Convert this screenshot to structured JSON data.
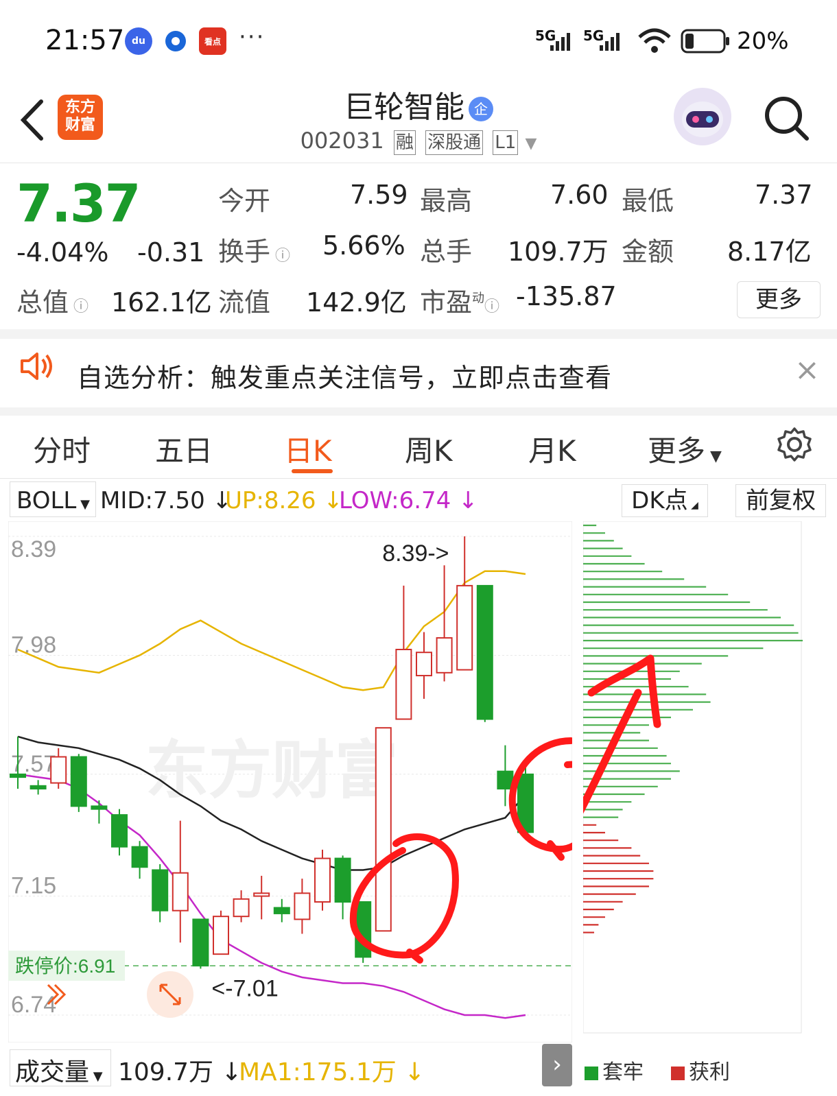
{
  "status_bar": {
    "time": "21:57",
    "app_icons": [
      "baidu-icon",
      "browser-icon",
      "kandian-icon"
    ],
    "app_icon_labels": [
      "du",
      "",
      "看点"
    ],
    "more": "···",
    "network1": "5G",
    "network2": "5G",
    "battery": "20%"
  },
  "header": {
    "logo_line1": "东方",
    "logo_line2": "财富",
    "stock_name": "巨轮智能",
    "name_badge": "企",
    "stock_code": "002031",
    "tags": [
      "融",
      "深股通",
      "L1"
    ]
  },
  "quote": {
    "price": "7.37",
    "change_pct": "-4.04%",
    "change": "-0.31",
    "rows": [
      [
        {
          "label": "今开",
          "value": "7.59",
          "green": true
        },
        {
          "label": "最高",
          "value": "7.60",
          "green": true
        },
        {
          "label": "最低",
          "value": "7.37",
          "green": true
        }
      ],
      [
        {
          "label": "换手",
          "value": "5.66%",
          "green": false
        },
        {
          "label": "总手",
          "value": "109.7万",
          "green": false
        },
        {
          "label": "金额",
          "value": "8.17亿",
          "green": false
        }
      ]
    ],
    "total_value_label": "总值",
    "total_value": "162.1亿",
    "float_value_label": "流值",
    "float_value": "142.9亿",
    "pe_label": "市盈",
    "pe_super": "动",
    "pe_value": "-135.87",
    "more_button": "更多"
  },
  "notice": {
    "text": "自选分析：触发重点关注信号，立即点击查看",
    "close": "×"
  },
  "tabs": {
    "items": [
      "分时",
      "五日",
      "日K",
      "周K",
      "月K",
      "更多"
    ],
    "active": "日K"
  },
  "indicator": {
    "name": "BOLL",
    "mid": "MID:7.50",
    "up": "UP:8.26",
    "low": "LOW:6.74",
    "dk_button": "DK点",
    "adjust_button": "前复权",
    "colors": {
      "mid": "#222222",
      "up": "#e6b400",
      "low": "#c427c8",
      "rise": "#d0302c",
      "fall": "#1c9e2c"
    }
  },
  "chart_data": {
    "type": "candlestick",
    "y_ticks": [
      "8.39",
      "7.98",
      "7.57",
      "7.15",
      "6.74"
    ],
    "ylim": [
      6.74,
      8.39
    ],
    "candles": [
      {
        "o": 7.57,
        "c": 7.56,
        "h": 7.7,
        "l": 7.52
      },
      {
        "o": 7.53,
        "c": 7.52,
        "h": 7.55,
        "l": 7.5
      },
      {
        "o": 7.54,
        "c": 7.63,
        "h": 7.66,
        "l": 7.52
      },
      {
        "o": 7.63,
        "c": 7.46,
        "h": 7.64,
        "l": 7.44
      },
      {
        "o": 7.46,
        "c": 7.45,
        "h": 7.48,
        "l": 7.4
      },
      {
        "o": 7.43,
        "c": 7.32,
        "h": 7.45,
        "l": 7.29
      },
      {
        "o": 7.32,
        "c": 7.25,
        "h": 7.34,
        "l": 7.21
      },
      {
        "o": 7.24,
        "c": 7.1,
        "h": 7.26,
        "l": 7.06
      },
      {
        "o": 7.1,
        "c": 7.23,
        "h": 7.41,
        "l": 6.99
      },
      {
        "o": 7.07,
        "c": 6.91,
        "h": 7.07,
        "l": 6.9
      },
      {
        "o": 6.95,
        "c": 7.08,
        "h": 7.1,
        "l": 7.01
      },
      {
        "o": 7.08,
        "c": 7.14,
        "h": 7.17,
        "l": 7.06
      },
      {
        "o": 7.15,
        "c": 7.16,
        "h": 7.22,
        "l": 7.07
      },
      {
        "o": 7.11,
        "c": 7.09,
        "h": 7.14,
        "l": 7.06
      },
      {
        "o": 7.07,
        "c": 7.16,
        "h": 7.21,
        "l": 7.02
      },
      {
        "o": 7.13,
        "c": 7.28,
        "h": 7.31,
        "l": 7.1
      },
      {
        "o": 7.28,
        "c": 7.13,
        "h": 7.29,
        "l": 7.07
      },
      {
        "o": 7.13,
        "c": 6.94,
        "h": 7.13,
        "l": 6.92
      },
      {
        "o": 7.03,
        "c": 7.73,
        "h": 7.73,
        "l": 7.03
      },
      {
        "o": 7.76,
        "c": 8.0,
        "h": 8.22,
        "l": 7.76
      },
      {
        "o": 7.91,
        "c": 7.99,
        "h": 8.06,
        "l": 7.83
      },
      {
        "o": 7.92,
        "c": 8.04,
        "h": 8.29,
        "l": 7.89
      },
      {
        "o": 7.93,
        "c": 8.22,
        "h": 8.39,
        "l": 7.93
      },
      {
        "o": 8.22,
        "c": 7.76,
        "h": 8.22,
        "l": 7.75
      },
      {
        "o": 7.58,
        "c": 7.52,
        "h": 7.67,
        "l": 7.46
      },
      {
        "o": 7.57,
        "c": 7.37,
        "h": 7.6,
        "l": 7.37
      }
    ],
    "boll_up": [
      8.0,
      7.97,
      7.94,
      7.93,
      7.92,
      7.95,
      7.98,
      8.02,
      8.07,
      8.1,
      8.06,
      8.02,
      7.99,
      7.96,
      7.93,
      7.9,
      7.87,
      7.86,
      7.87,
      7.99,
      8.08,
      8.13,
      8.23,
      8.27,
      8.27,
      8.26
    ],
    "boll_mid": [
      7.7,
      7.68,
      7.67,
      7.66,
      7.64,
      7.62,
      7.59,
      7.55,
      7.5,
      7.46,
      7.41,
      7.38,
      7.34,
      7.31,
      7.28,
      7.26,
      7.24,
      7.24,
      7.25,
      7.29,
      7.32,
      7.35,
      7.38,
      7.4,
      7.42,
      7.5
    ],
    "boll_low": [
      7.57,
      7.56,
      7.55,
      7.52,
      7.47,
      7.41,
      7.36,
      7.28,
      7.19,
      7.09,
      7.0,
      6.96,
      6.92,
      6.89,
      6.87,
      6.86,
      6.85,
      6.85,
      6.84,
      6.82,
      6.79,
      6.76,
      6.74,
      6.74,
      6.73,
      6.74
    ],
    "max_label": "8.39->",
    "min_label": "<-7.01",
    "limit_down_label": "跌停价:6.91",
    "limit_down": 6.91,
    "watermark": "东方财富",
    "volume_profile": {
      "trapped": [
        6,
        10,
        14,
        18,
        22,
        28,
        36,
        46,
        56,
        66,
        76,
        84,
        90,
        96,
        98,
        100,
        82,
        66,
        54,
        44,
        40,
        48,
        56,
        58,
        50,
        40,
        30,
        26,
        30,
        34,
        38,
        40,
        44,
        40,
        34,
        28,
        22,
        18,
        16
      ],
      "profit": [
        6,
        10,
        16,
        22,
        26,
        30,
        32,
        32,
        30,
        24,
        18,
        14,
        10,
        7,
        5
      ]
    },
    "profile_legend": [
      "套牢",
      "获利"
    ]
  },
  "volume": {
    "label": "成交量",
    "value": "109.7万",
    "ma1": "MA1:175.1万"
  }
}
